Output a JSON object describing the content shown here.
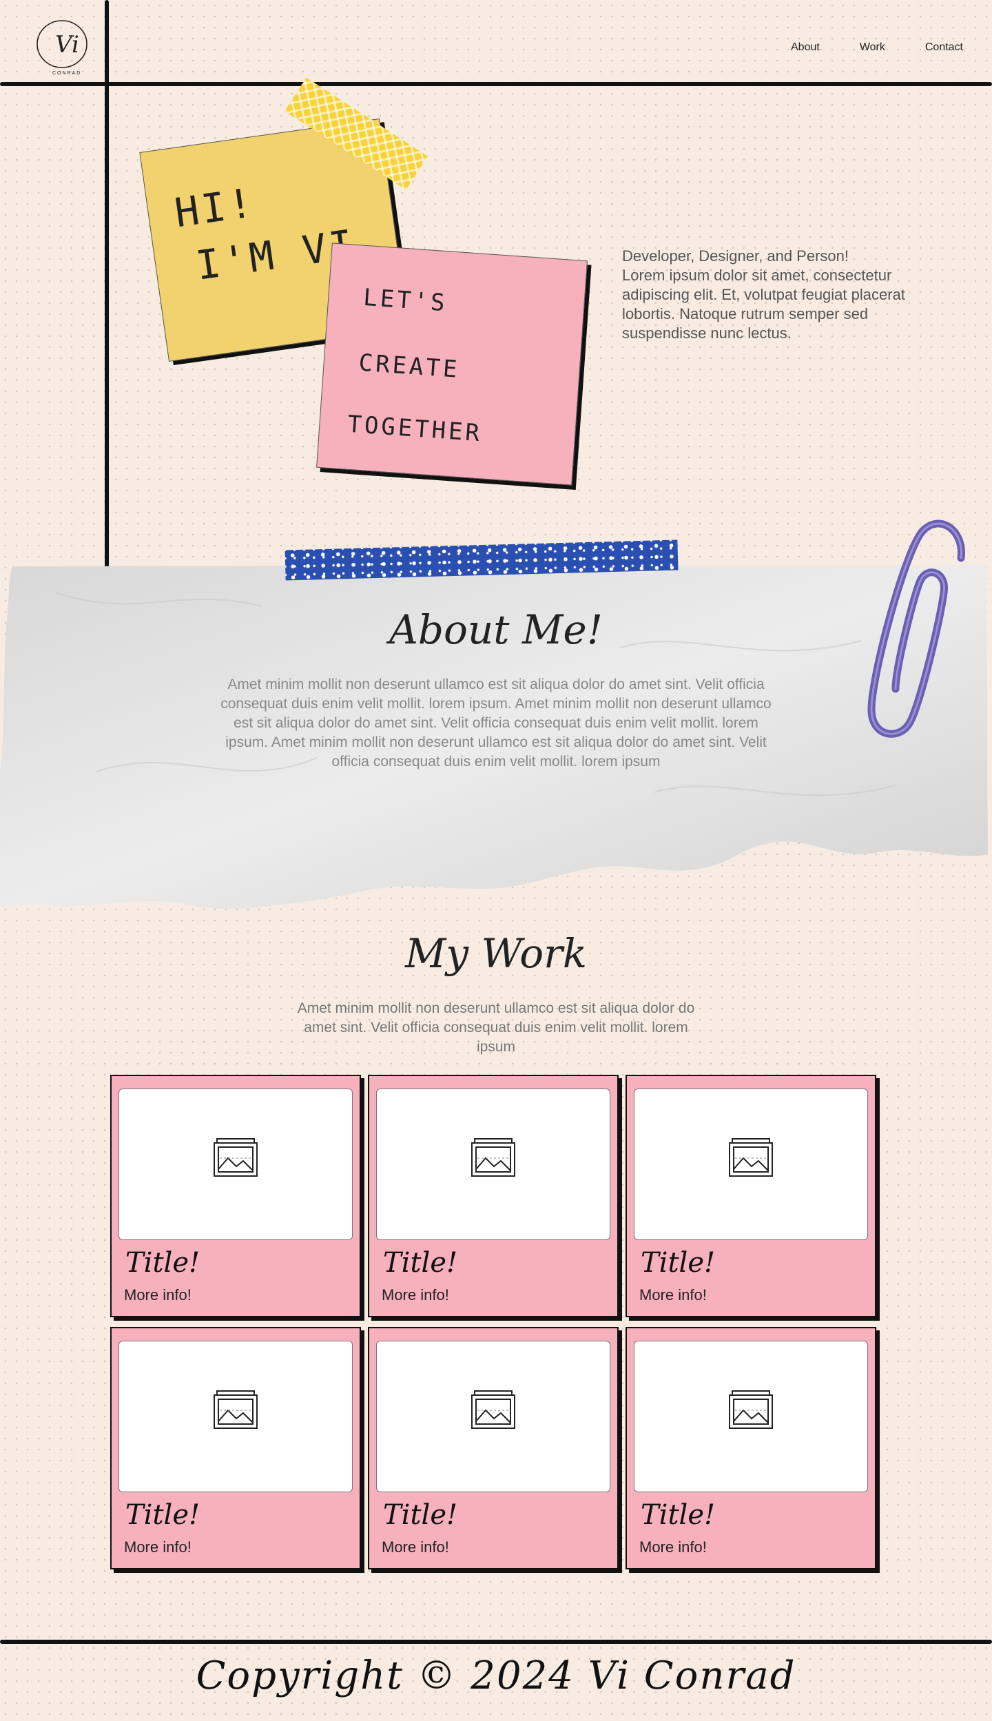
{
  "header": {
    "logo_text": "Vi",
    "logo_subtext": "CONRAD",
    "nav": [
      "About",
      "Work",
      "Contact"
    ]
  },
  "hero": {
    "yellow_note": [
      "HI!",
      "I'M VI"
    ],
    "pink_note": [
      "LET'S",
      "CREATE",
      "TOGETHER"
    ],
    "intro": [
      "Developer, Designer, and Person!",
      "Lorem ipsum dolor sit amet, consectetur adipiscing elit. Et, volutpat feugiat placerat lobortis. Natoque rutrum semper sed suspendisse nunc lectus."
    ]
  },
  "about": {
    "title": "About Me!",
    "body": "Amet minim mollit non deserunt ullamco est sit aliqua dolor do amet sint. Velit officia consequat duis enim velit mollit. lorem ipsum. Amet minim mollit non deserunt ullamco est sit aliqua dolor do amet sint. Velit officia consequat duis enim velit mollit. lorem ipsum. Amet minim mollit non deserunt ullamco est sit aliqua dolor do amet sint. Velit officia consequat duis enim velit mollit. lorem ipsum"
  },
  "work": {
    "title": "My Work",
    "body": "Amet minim mollit non deserunt ullamco est sit aliqua dolor do amet sint. Velit officia consequat duis enim velit mollit. lorem ipsum",
    "cards": [
      {
        "title": "Title!",
        "info": "More info!"
      },
      {
        "title": "Title!",
        "info": "More info!"
      },
      {
        "title": "Title!",
        "info": "More info!"
      },
      {
        "title": "Title!",
        "info": "More info!"
      },
      {
        "title": "Title!",
        "info": "More info!"
      },
      {
        "title": "Title!",
        "info": "More info!"
      }
    ]
  },
  "footer": {
    "copyright": "Copyright © 2024 Vi Conrad"
  },
  "colors": {
    "background": "#f8ece2",
    "note_yellow": "#f2d26e",
    "note_pink": "#f6b1bc",
    "tape_blue": "#2b4fb0",
    "paperclip": "#6a5fb0"
  }
}
